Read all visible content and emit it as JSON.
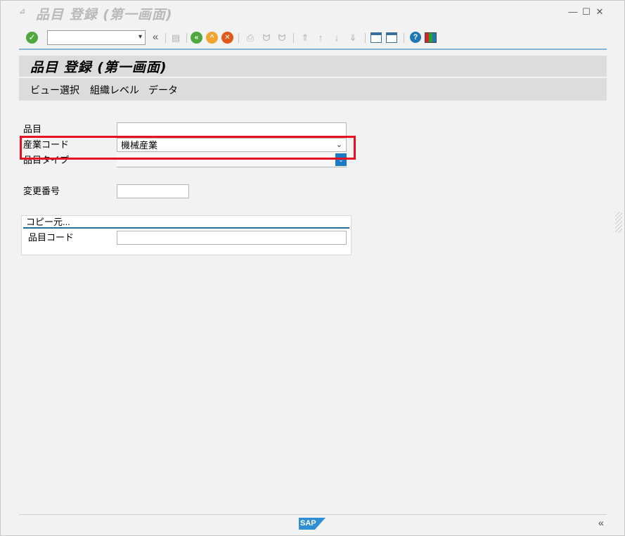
{
  "window": {
    "title": "品目 登録 (第一画面)",
    "controls": {
      "minimize": "—",
      "maximize": "☐",
      "close": "✕"
    }
  },
  "toolbar": {
    "command_field_value": "",
    "icons": [
      "enter-icon",
      "command-dropdown-icon",
      "collapse-icon",
      "save-icon",
      "back-icon",
      "exit-icon",
      "cancel-icon",
      "print-icon",
      "find-icon",
      "find-next-icon",
      "first-page-icon",
      "previous-page-icon",
      "next-page-icon",
      "last-page-icon",
      "new-session-icon",
      "shortcut-icon",
      "help-icon",
      "layout-icon"
    ]
  },
  "header": {
    "title": "品目 登録 (第一画面)"
  },
  "menu": {
    "items": [
      {
        "label": "ビュー選択"
      },
      {
        "label": "組織レベル"
      },
      {
        "label": "データ"
      }
    ]
  },
  "form": {
    "material": {
      "label": "品目",
      "value": ""
    },
    "industry": {
      "label": "産業コード",
      "value": "機械産業"
    },
    "material_type": {
      "label": "品目タイプ",
      "value": ""
    },
    "change_number": {
      "label": "変更番号",
      "value": ""
    }
  },
  "copy_from": {
    "title": "コピー元...",
    "material_code": {
      "label": "品目コード",
      "value": ""
    }
  },
  "footer": {
    "logo_text": "SAP",
    "collapse": "«"
  },
  "colors": {
    "highlight": "#e81123",
    "accent": "#1f6ea3",
    "header_bg": "#dcdcdc",
    "background": "#f2f2f2"
  }
}
